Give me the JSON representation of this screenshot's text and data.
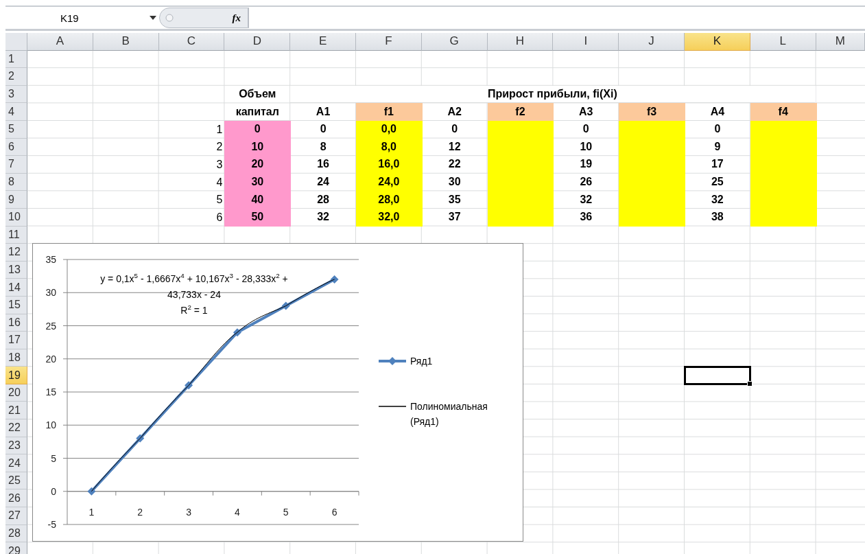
{
  "name_box": {
    "value": "K19"
  },
  "function_button": "fx",
  "column_headers": [
    {
      "label": "A",
      "selected": false
    },
    {
      "label": "B",
      "selected": false
    },
    {
      "label": "C",
      "selected": false
    },
    {
      "label": "D",
      "selected": false
    },
    {
      "label": "E",
      "selected": false
    },
    {
      "label": "F",
      "selected": false
    },
    {
      "label": "G",
      "selected": false
    },
    {
      "label": "H",
      "selected": false
    },
    {
      "label": "I",
      "selected": false
    },
    {
      "label": "J",
      "selected": false
    },
    {
      "label": "K",
      "selected": true
    },
    {
      "label": "L",
      "selected": false
    },
    {
      "label": "M",
      "selected": false
    }
  ],
  "row_headers": [
    {
      "label": "1",
      "selected": false
    },
    {
      "label": "2",
      "selected": false
    },
    {
      "label": "3",
      "selected": false
    },
    {
      "label": "4",
      "selected": false
    },
    {
      "label": "5",
      "selected": false
    },
    {
      "label": "6",
      "selected": false
    },
    {
      "label": "7",
      "selected": false
    },
    {
      "label": "8",
      "selected": false
    },
    {
      "label": "9",
      "selected": false
    },
    {
      "label": "10",
      "selected": false
    },
    {
      "label": "11",
      "selected": false
    },
    {
      "label": "12",
      "selected": false
    },
    {
      "label": "13",
      "selected": false
    },
    {
      "label": "14",
      "selected": false
    },
    {
      "label": "15",
      "selected": false
    },
    {
      "label": "16",
      "selected": false
    },
    {
      "label": "17",
      "selected": false
    },
    {
      "label": "18",
      "selected": false
    },
    {
      "label": "19",
      "selected": true
    },
    {
      "label": "20",
      "selected": false
    },
    {
      "label": "21",
      "selected": false
    },
    {
      "label": "22",
      "selected": false
    },
    {
      "label": "23",
      "selected": false
    },
    {
      "label": "24",
      "selected": false
    },
    {
      "label": "25",
      "selected": false
    },
    {
      "label": "26",
      "selected": false
    },
    {
      "label": "27",
      "selected": false
    },
    {
      "label": "28",
      "selected": false
    },
    {
      "label": "29",
      "selected": false
    }
  ],
  "table": {
    "group_title": "Прирост прибыли, fi(Xi)",
    "row_numbers": [
      "1",
      "2",
      "3",
      "4",
      "5",
      "6"
    ],
    "columns": [
      {
        "label": "Объем капитал",
        "color": "#ff99cc",
        "values": [
          "0",
          "10",
          "20",
          "30",
          "40",
          "50"
        ]
      },
      {
        "label": "A1",
        "values": [
          "0",
          "8",
          "16",
          "24",
          "28",
          "32"
        ]
      },
      {
        "label": "f1",
        "header": {
          "color": "#fcc99b"
        },
        "color": "#ffff00",
        "values": [
          "0,0",
          "8,0",
          "16,0",
          "24,0",
          "28,0",
          "32,0"
        ]
      },
      {
        "label": "A2",
        "values": [
          "0",
          "12",
          "22",
          "30",
          "35",
          "37"
        ]
      },
      {
        "label": "f2",
        "header": {
          "color": "#fcc99b"
        },
        "color": "#ffff00"
      },
      {
        "label": "A3",
        "values": [
          "0",
          "10",
          "19",
          "26",
          "32",
          "36"
        ]
      },
      {
        "label": "f3",
        "header": {
          "color": "#fcc99b"
        },
        "color": "#ffff00"
      },
      {
        "label": "A4",
        "values": [
          "0",
          "9",
          "17",
          "25",
          "32",
          "38"
        ]
      },
      {
        "label": "f4",
        "header": {
          "color": "#fcc99b"
        },
        "color": "#ffff00"
      }
    ]
  },
  "chart": {
    "chart_data": {
      "type": "line",
      "categories": [
        "1",
        "2",
        "3",
        "4",
        "5",
        "6"
      ],
      "series": [
        {
          "name": "Ряд1",
          "color": "#4f81bd",
          "marker": "diamond",
          "values": [
            0,
            8,
            16,
            24,
            28,
            32
          ]
        }
      ],
      "ylim": [
        -5,
        35
      ],
      "grid": true,
      "yticks": [
        {
          "value": -5,
          "label": "-5"
        },
        {
          "value": 0,
          "label": "0"
        },
        {
          "value": 5,
          "label": "5"
        },
        {
          "value": 10,
          "label": "10"
        },
        {
          "value": 15,
          "label": "15"
        },
        {
          "value": 20,
          "label": "20"
        },
        {
          "value": 25,
          "label": "25"
        },
        {
          "value": 30,
          "label": "30"
        },
        {
          "value": 35,
          "label": "35"
        }
      ],
      "annotations": [
        "y = 0,1x$^{5}$ - 1,6667x$^{4}$ + 10,167x$^{3}$ - 28,333x$^{2}$ + 43,733x - 24",
        "R$^{2}$ = 1"
      ]
    },
    "trendline": {
      "name": "Полиномиальная (Ряд1)",
      "color": "#000000"
    }
  }
}
